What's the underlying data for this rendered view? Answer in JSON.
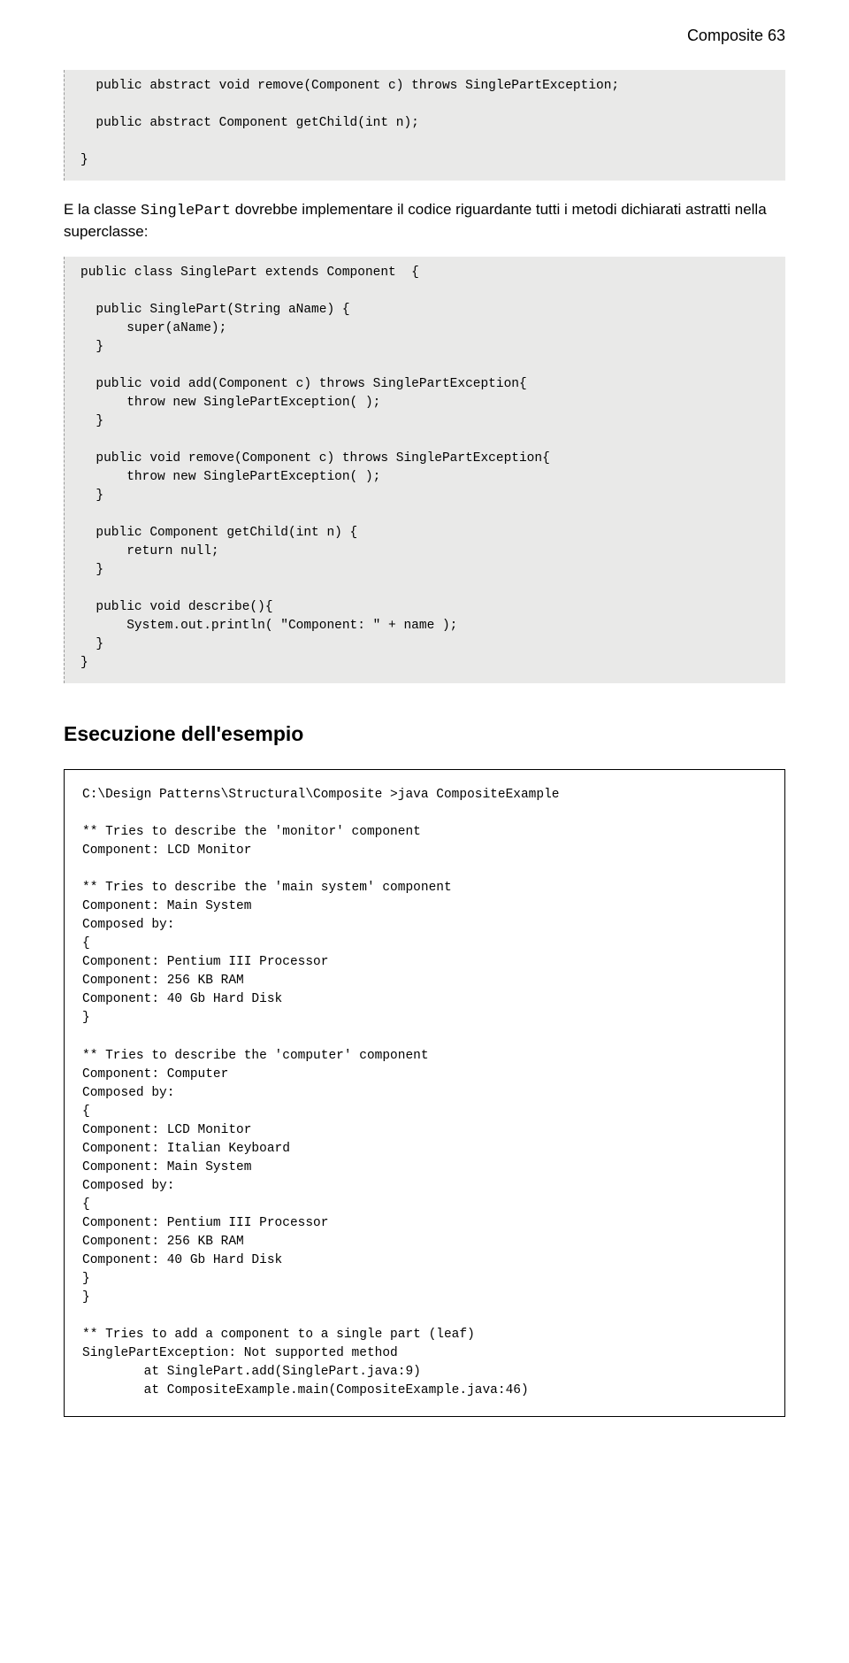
{
  "header": "Composite 63",
  "code1": "  public abstract void remove(Component c) throws SinglePartException;\n\n  public abstract Component getChild(int n);\n\n}",
  "para1_prefix": "E la classe ",
  "para1_mono": "SinglePart",
  "para1_rest": " dovrebbe implementare il codice riguardante tutti i metodi dichiarati astratti nella superclasse:",
  "code2": "public class SinglePart extends Component  {\n\n  public SinglePart(String aName) {\n      super(aName);\n  }\n\n  public void add(Component c) throws SinglePartException{\n      throw new SinglePartException( );\n  }\n\n  public void remove(Component c) throws SinglePartException{\n      throw new SinglePartException( );\n  }\n\n  public Component getChild(int n) {\n      return null;\n  }\n\n  public void describe(){\n      System.out.println( \"Component: \" + name );\n  }\n}",
  "heading": "Esecuzione dell'esempio",
  "output": "C:\\Design Patterns\\Structural\\Composite >java CompositeExample\n\n** Tries to describe the 'monitor' component\nComponent: LCD Monitor\n\n** Tries to describe the 'main system' component\nComponent: Main System\nComposed by:\n{\nComponent: Pentium III Processor\nComponent: 256 KB RAM\nComponent: 40 Gb Hard Disk\n}\n\n** Tries to describe the 'computer' component\nComponent: Computer\nComposed by:\n{\nComponent: LCD Monitor\nComponent: Italian Keyboard\nComponent: Main System\nComposed by:\n{\nComponent: Pentium III Processor\nComponent: 256 KB RAM\nComponent: 40 Gb Hard Disk\n}\n}\n\n** Tries to add a component to a single part (leaf)\nSinglePartException: Not supported method\n        at SinglePart.add(SinglePart.java:9)\n        at CompositeExample.main(CompositeExample.java:46)"
}
